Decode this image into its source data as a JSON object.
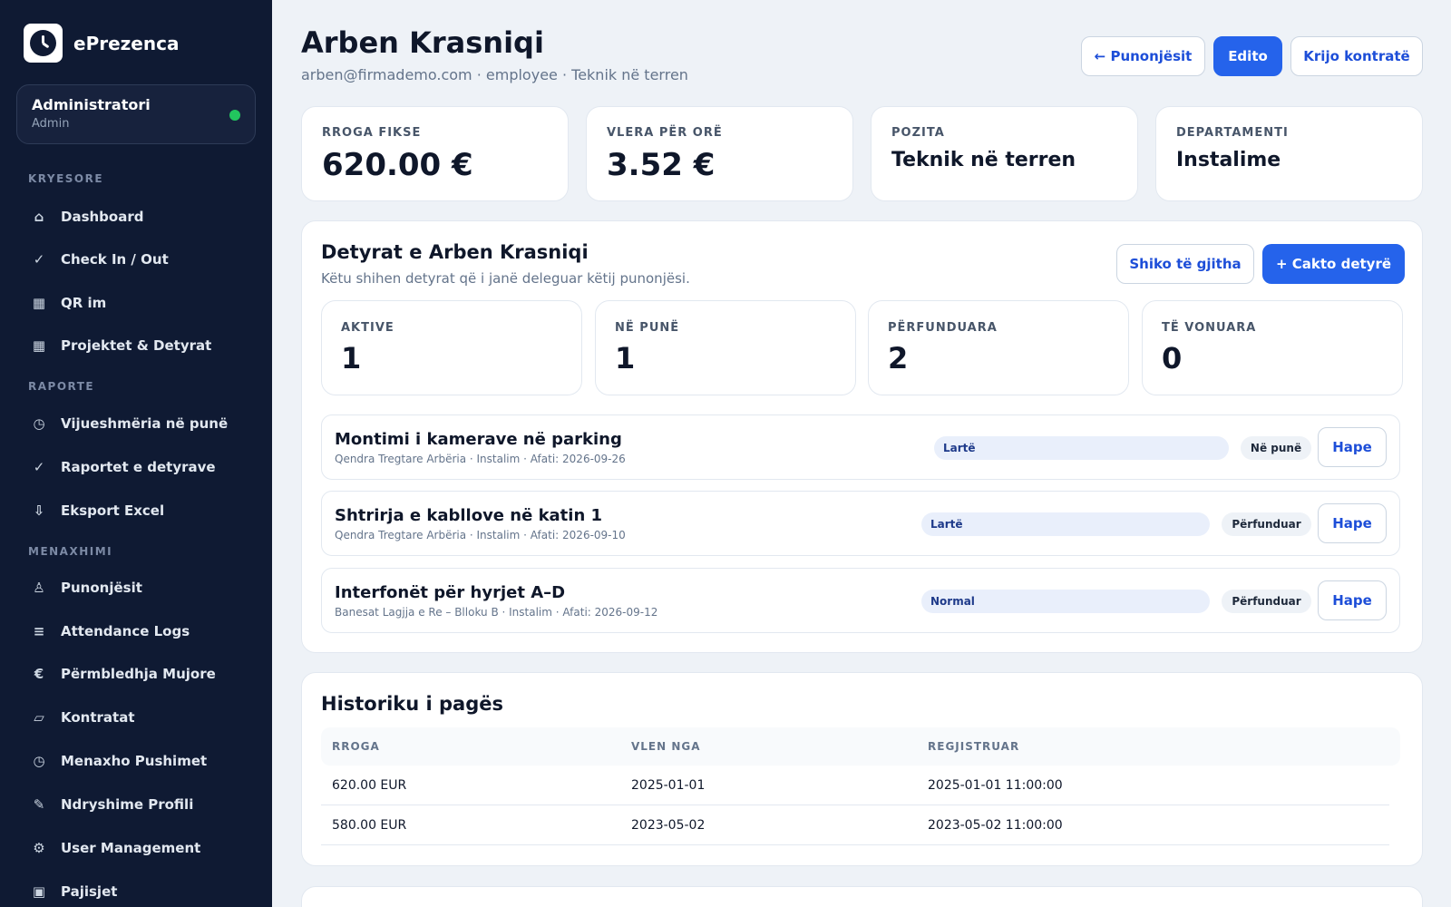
{
  "brand": {
    "name": "ePrezenca",
    "logo_icon": "clock-icon"
  },
  "user": {
    "name": "Administratori",
    "role": "Admin",
    "status_color": "#22c55e"
  },
  "sidebar": {
    "sections": [
      {
        "title": "KRYESORE",
        "items": [
          {
            "icon": "⌂",
            "icon_name": "home-icon",
            "label": "Dashboard"
          },
          {
            "icon": "✓",
            "icon_name": "check-icon",
            "label": "Check In / Out"
          },
          {
            "icon": "▦",
            "icon_name": "qr-icon",
            "label": "QR im"
          },
          {
            "icon": "▦",
            "icon_name": "grid-icon",
            "label": "Projektet & Detyrat"
          }
        ]
      },
      {
        "title": "RAPORTE",
        "items": [
          {
            "icon": "◷",
            "icon_name": "clock-icon",
            "label": "Vijueshmëria në punë"
          },
          {
            "icon": "✓",
            "icon_name": "check-icon",
            "label": "Raportet e detyrave"
          },
          {
            "icon": "⇩",
            "icon_name": "download-icon",
            "label": "Eksport Excel"
          }
        ]
      },
      {
        "title": "MENAXHIMI",
        "items": [
          {
            "icon": "♙",
            "icon_name": "user-icon",
            "label": "Punonjësit"
          },
          {
            "icon": "≡",
            "icon_name": "list-icon",
            "label": "Attendance Logs"
          },
          {
            "icon": "€",
            "icon_name": "euro-icon",
            "label": "Përmbledhja Mujore"
          },
          {
            "icon": "▱",
            "icon_name": "document-icon",
            "label": "Kontratat"
          },
          {
            "icon": "◷",
            "icon_name": "clock-icon",
            "label": "Menaxho Pushimet"
          },
          {
            "icon": "✎",
            "icon_name": "edit-icon",
            "label": "Ndryshime Profili"
          },
          {
            "icon": "⚙",
            "icon_name": "gear-icon",
            "label": "User Management"
          },
          {
            "icon": "▣",
            "icon_name": "device-icon",
            "label": "Pajisjet"
          }
        ]
      }
    ]
  },
  "header": {
    "title": "Arben Krasniqi",
    "subtitle": "arben@firmademo.com · employee · Teknik në terren",
    "back_label": "← Punonjësit",
    "edit_label": "Edito",
    "contract_label": "Krijo kontratë"
  },
  "stats": [
    {
      "label": "RROGA FIKSE",
      "value": "620.00 €"
    },
    {
      "label": "VLERA PËR ORË",
      "value": "3.52 €"
    },
    {
      "label": "POZITA",
      "value": "Teknik në terren"
    },
    {
      "label": "DEPARTAMENTI",
      "value": "Instalime"
    }
  ],
  "tasks_section": {
    "title": "Detyrat e Arben Krasniqi",
    "subtitle": "Këtu shihen detyrat që i janë deleguar këtij punonjësi.",
    "view_all_label": "Shiko të gjitha",
    "assign_label": "+ Cakto detyrë",
    "counters": [
      {
        "label": "AKTIVE",
        "value": "1"
      },
      {
        "label": "NË PUNË",
        "value": "1"
      },
      {
        "label": "PËRFUNDUARA",
        "value": "2"
      },
      {
        "label": "TË VONUARA",
        "value": "0"
      }
    ],
    "tasks": [
      {
        "title": "Montimi i kamerave në parking",
        "meta": "Qendra Tregtare Arbëria · Instalim · Afati: 2026-09-26",
        "priority": "Lartë",
        "status": "Në punë",
        "open_label": "Hape"
      },
      {
        "title": "Shtrirja e kabllove në katin 1",
        "meta": "Qendra Tregtare Arbëria · Instalim · Afati: 2026-09-10",
        "priority": "Lartë",
        "status": "Përfunduar",
        "open_label": "Hape"
      },
      {
        "title": "Interfonët për hyrjet A–D",
        "meta": "Banesat Lagjja e Re – Blloku B · Instalim · Afati: 2026-09-12",
        "priority": "Normal",
        "status": "Përfunduar",
        "open_label": "Hape"
      }
    ]
  },
  "salary_history": {
    "title": "Historiku i pagës",
    "columns": [
      "RROGA",
      "VLEN NGA",
      "REGJISTRUAR"
    ],
    "rows": [
      [
        "620.00 EUR",
        "2025-01-01",
        "2025-01-01 11:00:00"
      ],
      [
        "580.00 EUR",
        "2023-05-02",
        "2023-05-02 11:00:00"
      ]
    ]
  },
  "colors": {
    "accent": "#2563eb",
    "sidebar_bg": "#0f1a33",
    "page_bg": "#eef2f7"
  }
}
